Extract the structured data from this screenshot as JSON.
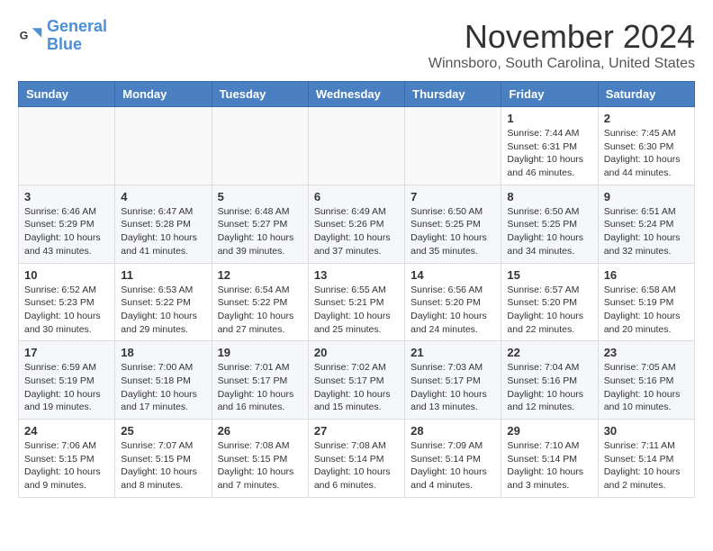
{
  "logo": {
    "line1": "General",
    "line2": "Blue"
  },
  "title": "November 2024",
  "location": "Winnsboro, South Carolina, United States",
  "weekdays": [
    "Sunday",
    "Monday",
    "Tuesday",
    "Wednesday",
    "Thursday",
    "Friday",
    "Saturday"
  ],
  "weeks": [
    [
      {
        "day": "",
        "info": ""
      },
      {
        "day": "",
        "info": ""
      },
      {
        "day": "",
        "info": ""
      },
      {
        "day": "",
        "info": ""
      },
      {
        "day": "",
        "info": ""
      },
      {
        "day": "1",
        "info": "Sunrise: 7:44 AM\nSunset: 6:31 PM\nDaylight: 10 hours\nand 46 minutes."
      },
      {
        "day": "2",
        "info": "Sunrise: 7:45 AM\nSunset: 6:30 PM\nDaylight: 10 hours\nand 44 minutes."
      }
    ],
    [
      {
        "day": "3",
        "info": "Sunrise: 6:46 AM\nSunset: 5:29 PM\nDaylight: 10 hours\nand 43 minutes."
      },
      {
        "day": "4",
        "info": "Sunrise: 6:47 AM\nSunset: 5:28 PM\nDaylight: 10 hours\nand 41 minutes."
      },
      {
        "day": "5",
        "info": "Sunrise: 6:48 AM\nSunset: 5:27 PM\nDaylight: 10 hours\nand 39 minutes."
      },
      {
        "day": "6",
        "info": "Sunrise: 6:49 AM\nSunset: 5:26 PM\nDaylight: 10 hours\nand 37 minutes."
      },
      {
        "day": "7",
        "info": "Sunrise: 6:50 AM\nSunset: 5:25 PM\nDaylight: 10 hours\nand 35 minutes."
      },
      {
        "day": "8",
        "info": "Sunrise: 6:50 AM\nSunset: 5:25 PM\nDaylight: 10 hours\nand 34 minutes."
      },
      {
        "day": "9",
        "info": "Sunrise: 6:51 AM\nSunset: 5:24 PM\nDaylight: 10 hours\nand 32 minutes."
      }
    ],
    [
      {
        "day": "10",
        "info": "Sunrise: 6:52 AM\nSunset: 5:23 PM\nDaylight: 10 hours\nand 30 minutes."
      },
      {
        "day": "11",
        "info": "Sunrise: 6:53 AM\nSunset: 5:22 PM\nDaylight: 10 hours\nand 29 minutes."
      },
      {
        "day": "12",
        "info": "Sunrise: 6:54 AM\nSunset: 5:22 PM\nDaylight: 10 hours\nand 27 minutes."
      },
      {
        "day": "13",
        "info": "Sunrise: 6:55 AM\nSunset: 5:21 PM\nDaylight: 10 hours\nand 25 minutes."
      },
      {
        "day": "14",
        "info": "Sunrise: 6:56 AM\nSunset: 5:20 PM\nDaylight: 10 hours\nand 24 minutes."
      },
      {
        "day": "15",
        "info": "Sunrise: 6:57 AM\nSunset: 5:20 PM\nDaylight: 10 hours\nand 22 minutes."
      },
      {
        "day": "16",
        "info": "Sunrise: 6:58 AM\nSunset: 5:19 PM\nDaylight: 10 hours\nand 20 minutes."
      }
    ],
    [
      {
        "day": "17",
        "info": "Sunrise: 6:59 AM\nSunset: 5:19 PM\nDaylight: 10 hours\nand 19 minutes."
      },
      {
        "day": "18",
        "info": "Sunrise: 7:00 AM\nSunset: 5:18 PM\nDaylight: 10 hours\nand 17 minutes."
      },
      {
        "day": "19",
        "info": "Sunrise: 7:01 AM\nSunset: 5:17 PM\nDaylight: 10 hours\nand 16 minutes."
      },
      {
        "day": "20",
        "info": "Sunrise: 7:02 AM\nSunset: 5:17 PM\nDaylight: 10 hours\nand 15 minutes."
      },
      {
        "day": "21",
        "info": "Sunrise: 7:03 AM\nSunset: 5:17 PM\nDaylight: 10 hours\nand 13 minutes."
      },
      {
        "day": "22",
        "info": "Sunrise: 7:04 AM\nSunset: 5:16 PM\nDaylight: 10 hours\nand 12 minutes."
      },
      {
        "day": "23",
        "info": "Sunrise: 7:05 AM\nSunset: 5:16 PM\nDaylight: 10 hours\nand 10 minutes."
      }
    ],
    [
      {
        "day": "24",
        "info": "Sunrise: 7:06 AM\nSunset: 5:15 PM\nDaylight: 10 hours\nand 9 minutes."
      },
      {
        "day": "25",
        "info": "Sunrise: 7:07 AM\nSunset: 5:15 PM\nDaylight: 10 hours\nand 8 minutes."
      },
      {
        "day": "26",
        "info": "Sunrise: 7:08 AM\nSunset: 5:15 PM\nDaylight: 10 hours\nand 7 minutes."
      },
      {
        "day": "27",
        "info": "Sunrise: 7:08 AM\nSunset: 5:14 PM\nDaylight: 10 hours\nand 6 minutes."
      },
      {
        "day": "28",
        "info": "Sunrise: 7:09 AM\nSunset: 5:14 PM\nDaylight: 10 hours\nand 4 minutes."
      },
      {
        "day": "29",
        "info": "Sunrise: 7:10 AM\nSunset: 5:14 PM\nDaylight: 10 hours\nand 3 minutes."
      },
      {
        "day": "30",
        "info": "Sunrise: 7:11 AM\nSunset: 5:14 PM\nDaylight: 10 hours\nand 2 minutes."
      }
    ]
  ]
}
